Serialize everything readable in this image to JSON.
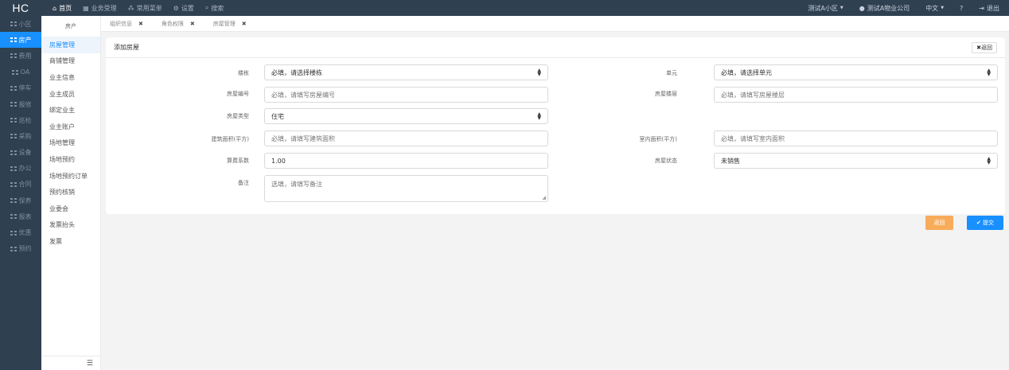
{
  "app": {
    "logo": "HC"
  },
  "topnav": [
    {
      "label": "首页",
      "icon": "home-icon",
      "glyph": "⌂",
      "active": true
    },
    {
      "label": "业务受理",
      "icon": "grid-icon",
      "glyph": "▦",
      "active": false
    },
    {
      "label": "常用菜单",
      "icon": "sitemap-icon",
      "glyph": "⁂",
      "active": false
    },
    {
      "label": "设置",
      "icon": "gear-icon",
      "glyph": "⚙",
      "active": false
    },
    {
      "label": "搜索",
      "icon": "search-icon",
      "glyph": "⌕",
      "active": false
    }
  ],
  "topright": {
    "community": "测试A小区",
    "user": "测试A物业公司",
    "language": "中文",
    "help_glyph": "?",
    "logout": "退出"
  },
  "sidebar": [
    {
      "label": "小区"
    },
    {
      "label": "房产",
      "active": true
    },
    {
      "label": "费用"
    },
    {
      "label": "OA"
    },
    {
      "label": "停车"
    },
    {
      "label": "报修"
    },
    {
      "label": "巡检"
    },
    {
      "label": "采购"
    },
    {
      "label": "设备"
    },
    {
      "label": "办公"
    },
    {
      "label": "合同"
    },
    {
      "label": "保养"
    },
    {
      "label": "报表"
    },
    {
      "label": "优惠"
    },
    {
      "label": "预约"
    }
  ],
  "submenu": {
    "title": "房产",
    "items": [
      {
        "label": "房屋管理",
        "active": true
      },
      {
        "label": "商铺管理"
      },
      {
        "label": "业主信息"
      },
      {
        "label": "业主成员"
      },
      {
        "label": "绑定业主"
      },
      {
        "label": "业主账户"
      },
      {
        "label": "场地管理"
      },
      {
        "label": "场地预约"
      },
      {
        "label": "场地预约订单"
      },
      {
        "label": "预约核销"
      },
      {
        "label": "业委会"
      },
      {
        "label": "发票抬头"
      },
      {
        "label": "发票"
      }
    ],
    "collapse_glyph": "☰"
  },
  "tabs": [
    {
      "label": "组织信息",
      "close": "✖"
    },
    {
      "label": "角色权限",
      "close": "✖"
    },
    {
      "label": "房屋管理",
      "close": "✖"
    }
  ],
  "form": {
    "title": "添加房屋",
    "back_top": "✖返回",
    "building": {
      "label": "楼栋",
      "value": "必填，请选择楼栋"
    },
    "unit": {
      "label": "单元",
      "value": "必填，请选择单元"
    },
    "room_no": {
      "label": "房屋编号",
      "placeholder": "必填，请填写房屋编号"
    },
    "floor": {
      "label": "房屋楼层",
      "placeholder": "必填，请填写房屋楼层"
    },
    "room_type": {
      "label": "房屋类型",
      "value": "住宅"
    },
    "built_area": {
      "label": "建筑面积(平方)",
      "placeholder": "必填，请填写建筑面积"
    },
    "inner_area": {
      "label": "室内面积(平方)",
      "placeholder": "必填，请填写室内面积"
    },
    "fee_coefficient": {
      "label": "算费系数",
      "value": "1.00"
    },
    "room_status": {
      "label": "房屋状态",
      "value": "未销售"
    },
    "remark": {
      "label": "备注",
      "placeholder": "选填，请填写备注"
    }
  },
  "actions": {
    "back": "返回",
    "submit": "✔ 提交"
  },
  "colors": {
    "nav_bg": "#2f4050",
    "accent": "#1890ff",
    "back_btn": "#f8ac59"
  }
}
